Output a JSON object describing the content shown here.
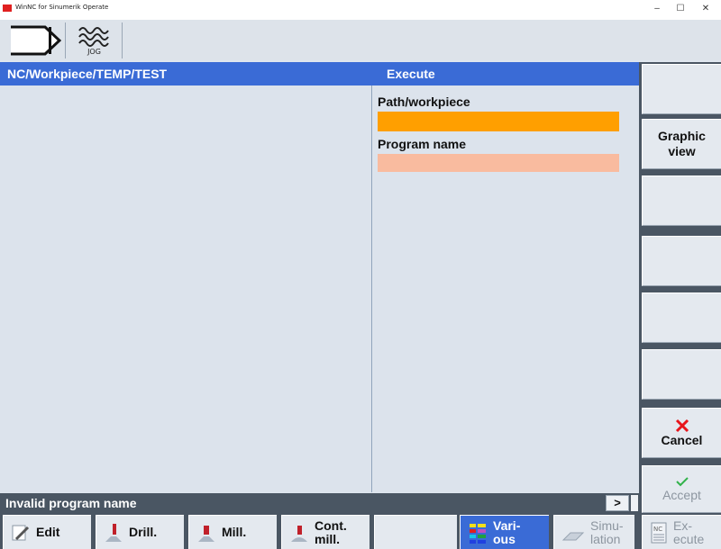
{
  "window": {
    "title": "WinNC for Sinumerik Operate",
    "minimize": "–",
    "maximize": "☐",
    "close": "✕"
  },
  "toolbar": {
    "mode_label": "JOG"
  },
  "header": {
    "path": "NC/Workpiece/TEMP/TEST",
    "dialog_title": "Execute"
  },
  "form": {
    "path_label": "Path/workpiece",
    "path_value": "",
    "program_label": "Program name",
    "program_value": ""
  },
  "vertical_softkeys": {
    "graphic_view": "Graphic\nview",
    "cancel": "Cancel",
    "accept": "Accept"
  },
  "status": {
    "message": "Invalid program name",
    "more": ">"
  },
  "horizontal_softkeys": {
    "edit": "Edit",
    "drill": "Drill.",
    "mill": "Mill.",
    "cont_mill": "Cont.\nmill.",
    "various": "Vari-\nous",
    "simulation": "Simu-\nlation",
    "execute": "Ex-\necute"
  },
  "colors": {
    "header_blue": "#3a6bd6",
    "path_field": "#ff9f00",
    "program_field": "#f9bb9f",
    "cancel_red": "#e8151b",
    "accept_green": "#31b24a"
  },
  "icons": {
    "mode": "operating-mode-arrow-icon",
    "jog": "jog-wave-icon",
    "cancel": "x-mark-icon",
    "accept": "checkmark-icon"
  }
}
